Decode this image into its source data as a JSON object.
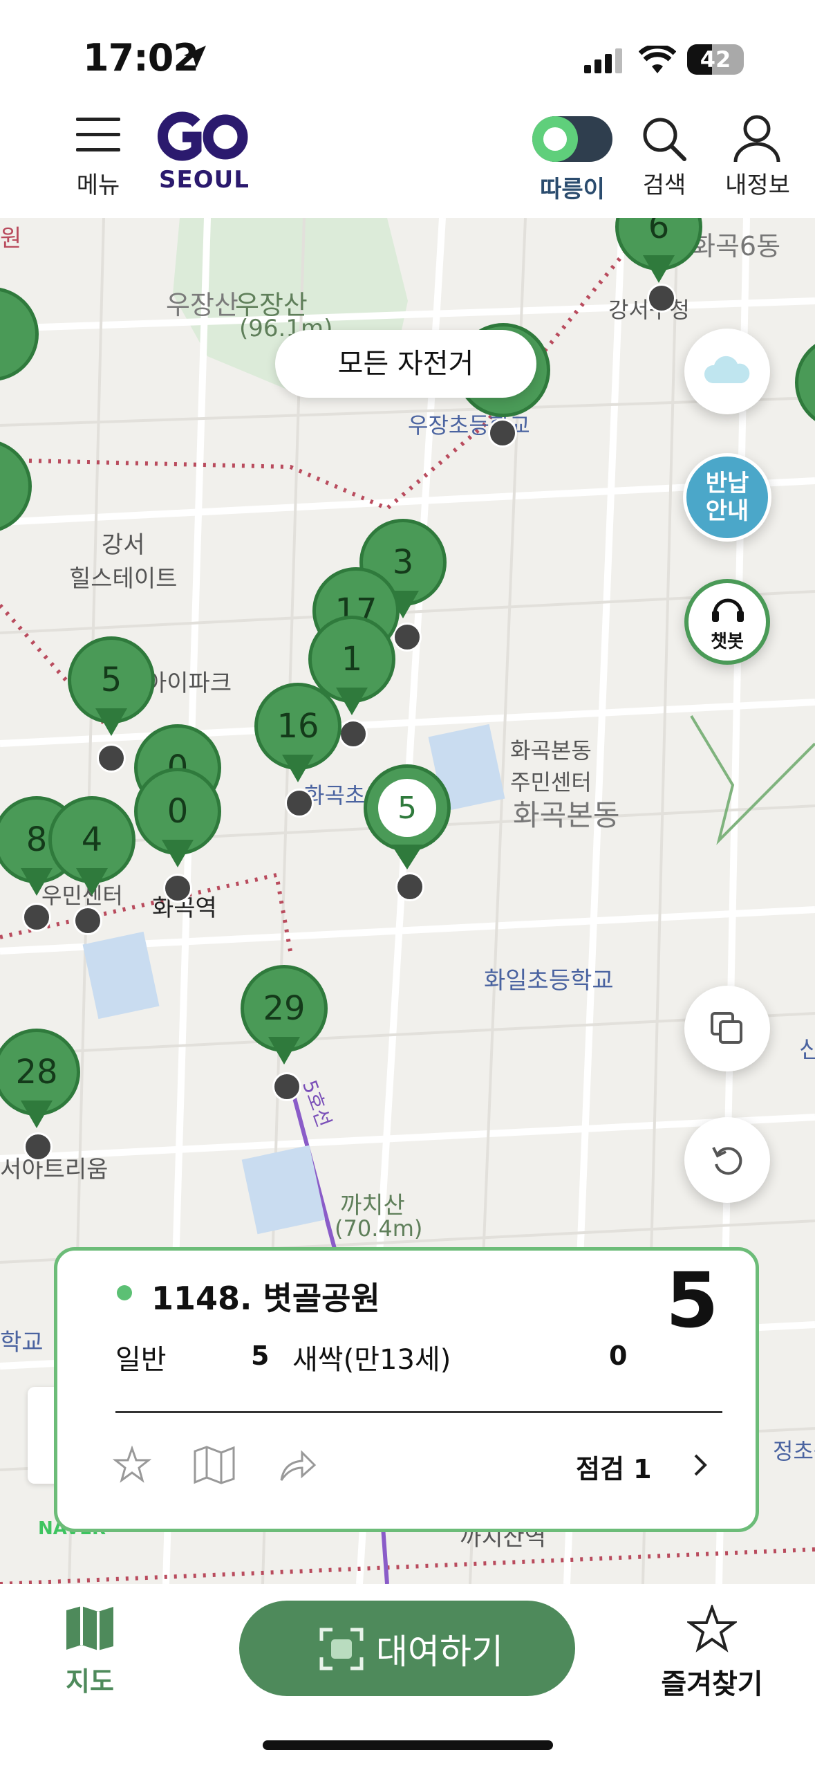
{
  "status": {
    "time": "17:02",
    "battery": "42"
  },
  "header": {
    "menu_label": "메뉴",
    "logo_text": "SEOUL",
    "toggle_label": "따릉이",
    "search_label": "검색",
    "profile_label": "내정보"
  },
  "map": {
    "filter_chip": "모든 자전거",
    "labels": {
      "woojangsan": "우장산",
      "woojangsan2": "우장산",
      "woojangsan_height": "(96.1m)",
      "gangseo_hill": "강서\n힐스테이트",
      "woojang_school": "우장초등학교",
      "gangseo_office": "강서구청",
      "hwagok6": "화곡6동",
      "ipark": "아이파크",
      "hwagokbon_center": "화곡본동\n주민센터",
      "hwagokbon": "화곡본동",
      "hwagok_station": "화곡역",
      "hwagokcho": "화곡초",
      "hwail_school": "화일초등학교",
      "line5": "5호선",
      "kkachisan": "까치산",
      "kkachisan_height": "(70.4m)",
      "seoul_trium": "서아트리움",
      "school_left": "학교",
      "right_school": "정초등",
      "naver": "NAVER",
      "left_top": "원",
      "dong_partial": "신",
      "lower_partial": "까치산역",
      "center_partial": "우민센터"
    },
    "pins": [
      {
        "count": "6"
      },
      {
        "count": "3"
      },
      {
        "count": "17"
      },
      {
        "count": "1"
      },
      {
        "count": "5"
      },
      {
        "count": "16"
      },
      {
        "count": "0"
      },
      {
        "count": "0"
      },
      {
        "count": "8"
      },
      {
        "count": "4"
      },
      {
        "count": "29"
      },
      {
        "count": "28"
      }
    ],
    "selected_pin_count": "5",
    "fab": {
      "weather_icon": "cloud-icon",
      "return_guide": "반납\n안내",
      "chatbot": "챗봇",
      "layers_icon": "layers-icon",
      "refresh_icon": "refresh-icon"
    },
    "colors": {
      "pin_green": "#4a9a57",
      "pin_border": "#2f7a3c",
      "accent": "#4e8a5b"
    }
  },
  "station_card": {
    "name": "1148. 볏골공원",
    "total": "5",
    "general_label": "일반",
    "general_count": "5",
    "junior_label": "새싹(만13세)",
    "junior_count": "0",
    "inspection": "점검 1"
  },
  "bottom_nav": {
    "map_label": "지도",
    "rent_label": "대여하기",
    "favorites_label": "즐겨찾기"
  }
}
